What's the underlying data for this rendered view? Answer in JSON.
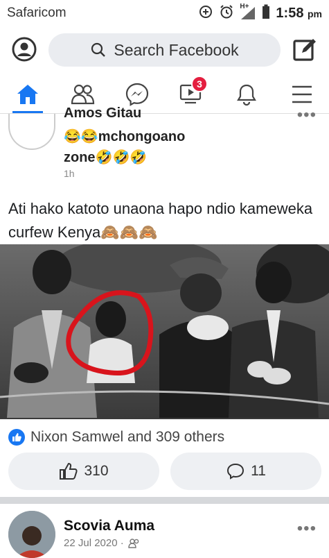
{
  "status_bar": {
    "carrier": "Safaricom",
    "network": "H+",
    "time": "1:58",
    "ampm": "pm"
  },
  "top_bar": {
    "search_placeholder": "Search Facebook"
  },
  "tabs": {
    "video_badge": "3",
    "accent": "#1877f2",
    "items": [
      "home-icon",
      "friends-icon",
      "messenger-icon",
      "video-icon",
      "bell-icon",
      "menu-icon"
    ]
  },
  "post1": {
    "author_partial": "Amos Gitau",
    "group_line1": "😂😂mchongoano",
    "group_line2": "zone🤣🤣🤣",
    "time": "1h",
    "caption": "Ati hako katoto unaona hapo ndio kameweka curfew Kenya🙈🙈🙈",
    "reactions_text": "Nixon Samwel and 309 others",
    "likes": "310",
    "comments": "11"
  },
  "post2": {
    "author": "Scovia Auma",
    "date": "22 Jul 2020 ·"
  }
}
